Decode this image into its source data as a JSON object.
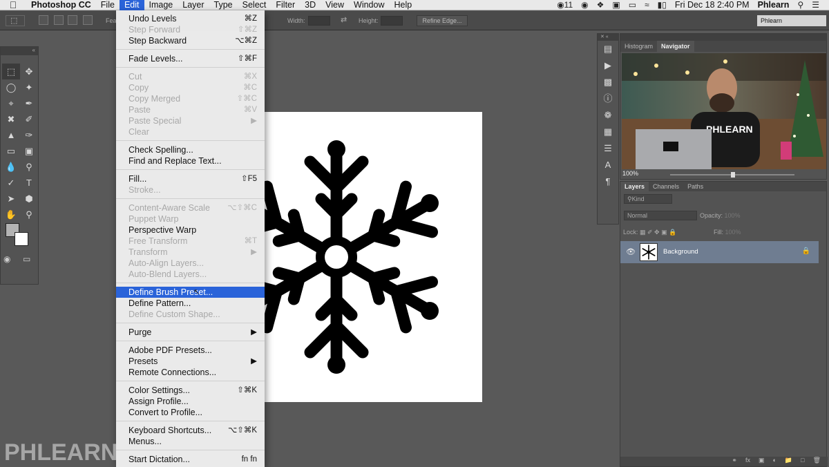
{
  "menubar": {
    "apple": "",
    "app_name": "Photoshop CC",
    "menus": [
      "File",
      "Edit",
      "Image",
      "Layer",
      "Type",
      "Select",
      "Filter",
      "3D",
      "View",
      "Window",
      "Help"
    ],
    "active_menu": "Edit",
    "notification_count": "11",
    "clock": "Fri Dec 18  2:40 PM",
    "user": "Phlearn"
  },
  "options_bar": {
    "feather_label": "Fea",
    "width_label": "Width:",
    "height_label": "Height:",
    "refine_edge": "Refine Edge...",
    "workspace": "Phlearn"
  },
  "edit_menu": {
    "groups": [
      [
        {
          "label": "Undo Levels",
          "shortcut": "⌘Z",
          "enabled": true
        },
        {
          "label": "Step Forward",
          "shortcut": "⇧⌘Z",
          "enabled": false
        },
        {
          "label": "Step Backward",
          "shortcut": "⌥⌘Z",
          "enabled": true
        }
      ],
      [
        {
          "label": "Fade Levels...",
          "shortcut": "⇧⌘F",
          "enabled": true
        }
      ],
      [
        {
          "label": "Cut",
          "shortcut": "⌘X",
          "enabled": false
        },
        {
          "label": "Copy",
          "shortcut": "⌘C",
          "enabled": false
        },
        {
          "label": "Copy Merged",
          "shortcut": "⇧⌘C",
          "enabled": false
        },
        {
          "label": "Paste",
          "shortcut": "⌘V",
          "enabled": false
        },
        {
          "label": "Paste Special",
          "shortcut": "▶",
          "enabled": false
        },
        {
          "label": "Clear",
          "shortcut": "",
          "enabled": false
        }
      ],
      [
        {
          "label": "Check Spelling...",
          "shortcut": "",
          "enabled": true
        },
        {
          "label": "Find and Replace Text...",
          "shortcut": "",
          "enabled": true
        }
      ],
      [
        {
          "label": "Fill...",
          "shortcut": "⇧F5",
          "enabled": true
        },
        {
          "label": "Stroke...",
          "shortcut": "",
          "enabled": false
        }
      ],
      [
        {
          "label": "Content-Aware Scale",
          "shortcut": "⌥⇧⌘C",
          "enabled": false
        },
        {
          "label": "Puppet Warp",
          "shortcut": "",
          "enabled": false
        },
        {
          "label": "Perspective Warp",
          "shortcut": "",
          "enabled": true
        },
        {
          "label": "Free Transform",
          "shortcut": "⌘T",
          "enabled": false
        },
        {
          "label": "Transform",
          "shortcut": "▶",
          "enabled": false
        },
        {
          "label": "Auto-Align Layers...",
          "shortcut": "",
          "enabled": false
        },
        {
          "label": "Auto-Blend Layers...",
          "shortcut": "",
          "enabled": false
        }
      ],
      [
        {
          "label": "Define Brush Preset...",
          "shortcut": "",
          "enabled": true,
          "highlighted": true
        },
        {
          "label": "Define Pattern...",
          "shortcut": "",
          "enabled": true
        },
        {
          "label": "Define Custom Shape...",
          "shortcut": "",
          "enabled": false
        }
      ],
      [
        {
          "label": "Purge",
          "shortcut": "▶",
          "enabled": true
        }
      ],
      [
        {
          "label": "Adobe PDF Presets...",
          "shortcut": "",
          "enabled": true
        },
        {
          "label": "Presets",
          "shortcut": "▶",
          "enabled": true
        },
        {
          "label": "Remote Connections...",
          "shortcut": "",
          "enabled": true
        }
      ],
      [
        {
          "label": "Color Settings...",
          "shortcut": "⇧⌘K",
          "enabled": true
        },
        {
          "label": "Assign Profile...",
          "shortcut": "",
          "enabled": true
        },
        {
          "label": "Convert to Profile...",
          "shortcut": "",
          "enabled": true
        }
      ],
      [
        {
          "label": "Keyboard Shortcuts...",
          "shortcut": "⌥⇧⌘K",
          "enabled": true
        },
        {
          "label": "Menus...",
          "shortcut": "",
          "enabled": true
        }
      ],
      [
        {
          "label": "Start Dictation...",
          "shortcut": "fn fn",
          "enabled": true
        }
      ]
    ]
  },
  "navigator": {
    "tabs": [
      "Histogram",
      "Navigator"
    ],
    "active_tab": "Navigator",
    "zoom": "100%",
    "shirt_text": "PHLEARN"
  },
  "layers_panel": {
    "tabs": [
      "Layers",
      "Channels",
      "Paths"
    ],
    "active_tab": "Layers",
    "filter_kind": "Kind",
    "blend_mode": "Normal",
    "opacity_label": "Opacity:",
    "opacity_value": "100%",
    "lock_label": "Lock:",
    "fill_label": "Fill:",
    "fill_value": "100%",
    "layers": [
      {
        "name": "Background",
        "visible": true,
        "locked": true
      }
    ]
  },
  "watermark": "PHLEARN",
  "colors": {
    "menu_highlight": "#2a63d9",
    "ps_background": "#595959",
    "layer_selected": "#6f7d91"
  }
}
